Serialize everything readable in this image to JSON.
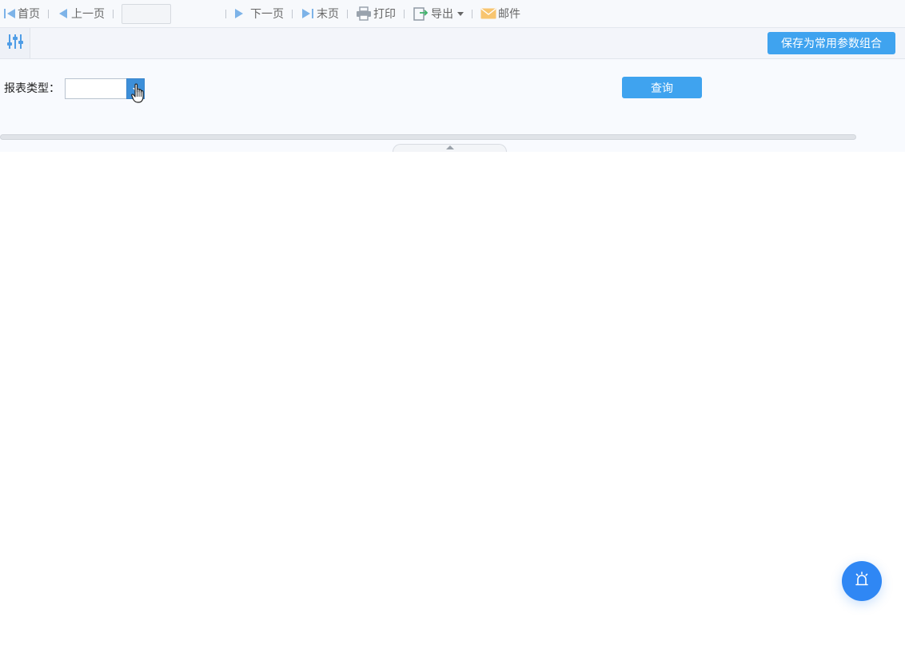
{
  "toolbar": {
    "first_label": "首页",
    "prev_label": "上一页",
    "page_value": "",
    "next_label": "下一页",
    "last_label": "末页",
    "print_label": "打印",
    "export_label": "导出",
    "mail_label": "邮件"
  },
  "param_panel": {
    "save_combo_label": "保存为常用参数组合"
  },
  "form": {
    "report_type_label": "报表类型：",
    "report_type_value": "",
    "query_label": "查询"
  },
  "icons": {
    "first": "first-page-icon",
    "prev": "prev-page-icon",
    "next": "next-page-icon",
    "last": "last-page-icon",
    "print": "printer-icon",
    "export": "export-icon",
    "mail": "mail-icon",
    "param_toggle": "sliders-icon",
    "float": "alarm-icon"
  },
  "colors": {
    "accent": "#3fa3ef",
    "icon_blue": "#6aa9e4",
    "float_button": "#2f87f4",
    "mail_icon": "#f5b14c"
  }
}
